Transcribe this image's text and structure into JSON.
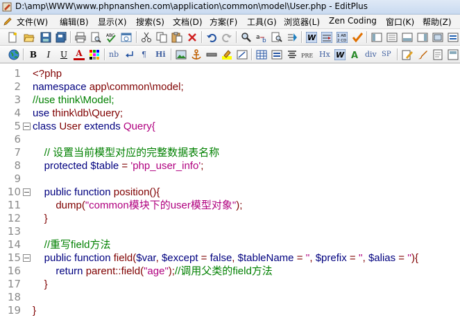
{
  "window": {
    "title": "D:\\amp\\WWW\\www.phpnanshen.com\\application\\common\\model\\User.php - EditPlus"
  },
  "menu": [
    "文件(W)",
    "编辑(B)",
    "显示(X)",
    "搜索(S)",
    "文档(D)",
    "方案(F)",
    "工具(G)",
    "浏览器(L)",
    "Zen Coding",
    "窗口(K)",
    "帮助(Z)"
  ],
  "toolbar2_text": [
    "B",
    "I",
    "U",
    "A",
    "nb",
    "¶",
    "Hi",
    "PRE",
    "Hx",
    "div",
    "SP"
  ],
  "code_lines": [
    {
      "n": "1",
      "fold": false,
      "segments": [
        {
          "t": "<?php",
          "c": "tag"
        }
      ]
    },
    {
      "n": "2",
      "fold": false,
      "segments": [
        {
          "t": "namespace ",
          "c": "kw"
        },
        {
          "t": "app\\common\\model;",
          "c": "cls"
        }
      ]
    },
    {
      "n": "3",
      "fold": false,
      "segments": [
        {
          "t": "//use think\\Model;",
          "c": "cm"
        }
      ]
    },
    {
      "n": "4",
      "fold": false,
      "segments": [
        {
          "t": "use ",
          "c": "kw"
        },
        {
          "t": "think\\db\\Query;",
          "c": "cls"
        }
      ]
    },
    {
      "n": "5",
      "fold": true,
      "segments": [
        {
          "t": "class ",
          "c": "kw"
        },
        {
          "t": "User ",
          "c": "cls"
        },
        {
          "t": "extends ",
          "c": "kw"
        },
        {
          "t": "Query{",
          "c": "str"
        }
      ]
    },
    {
      "n": "6",
      "fold": false,
      "segments": []
    },
    {
      "n": "7",
      "fold": false,
      "segments": [
        {
          "t": "    // 设置当前模型对应的完整数据表名称",
          "c": "cm"
        }
      ]
    },
    {
      "n": "8",
      "fold": false,
      "segments": [
        {
          "t": "    protected ",
          "c": "kw"
        },
        {
          "t": "$table",
          "c": "var"
        },
        {
          "t": " = ",
          "c": "op"
        },
        {
          "t": "'php_user_info'",
          "c": "str"
        },
        {
          "t": ";",
          "c": "op"
        }
      ]
    },
    {
      "n": "9",
      "fold": false,
      "segments": []
    },
    {
      "n": "10",
      "fold": true,
      "segments": [
        {
          "t": "    public function ",
          "c": "kw"
        },
        {
          "t": "position(){",
          "c": "cls"
        }
      ]
    },
    {
      "n": "11",
      "fold": false,
      "segments": [
        {
          "t": "        dump(",
          "c": "cls"
        },
        {
          "t": "\"common模块下的user模型对象\"",
          "c": "str"
        },
        {
          "t": ");",
          "c": "cls"
        }
      ]
    },
    {
      "n": "12",
      "fold": false,
      "segments": [
        {
          "t": "    }",
          "c": "cls"
        }
      ]
    },
    {
      "n": "13",
      "fold": false,
      "segments": []
    },
    {
      "n": "14",
      "fold": false,
      "segments": [
        {
          "t": "    //重写field方法",
          "c": "cm"
        }
      ]
    },
    {
      "n": "15",
      "fold": true,
      "segments": [
        {
          "t": "    public function ",
          "c": "kw"
        },
        {
          "t": "field(",
          "c": "cls"
        },
        {
          "t": "$var",
          "c": "var"
        },
        {
          "t": ", ",
          "c": "cls"
        },
        {
          "t": "$except",
          "c": "var"
        },
        {
          "t": " = ",
          "c": "op"
        },
        {
          "t": "false",
          "c": "kw"
        },
        {
          "t": ", ",
          "c": "cls"
        },
        {
          "t": "$tableName",
          "c": "var"
        },
        {
          "t": " = ",
          "c": "op"
        },
        {
          "t": "''",
          "c": "str"
        },
        {
          "t": ", ",
          "c": "cls"
        },
        {
          "t": "$prefix",
          "c": "var"
        },
        {
          "t": " = ",
          "c": "op"
        },
        {
          "t": "''",
          "c": "str"
        },
        {
          "t": ", ",
          "c": "cls"
        },
        {
          "t": "$alias",
          "c": "var"
        },
        {
          "t": " = ",
          "c": "op"
        },
        {
          "t": "''",
          "c": "str"
        },
        {
          "t": "){",
          "c": "cls"
        }
      ]
    },
    {
      "n": "16",
      "fold": false,
      "segments": [
        {
          "t": "        return ",
          "c": "kw"
        },
        {
          "t": "parent::field(",
          "c": "cls"
        },
        {
          "t": "\"age\"",
          "c": "str"
        },
        {
          "t": ");",
          "c": "cls"
        },
        {
          "t": "//调用父类的field方法",
          "c": "cm"
        }
      ]
    },
    {
      "n": "17",
      "fold": false,
      "segments": [
        {
          "t": "    }",
          "c": "cls"
        }
      ]
    },
    {
      "n": "18",
      "fold": false,
      "segments": []
    },
    {
      "n": "19",
      "fold": false,
      "segments": [
        {
          "t": "}",
          "c": "cls"
        }
      ]
    }
  ]
}
